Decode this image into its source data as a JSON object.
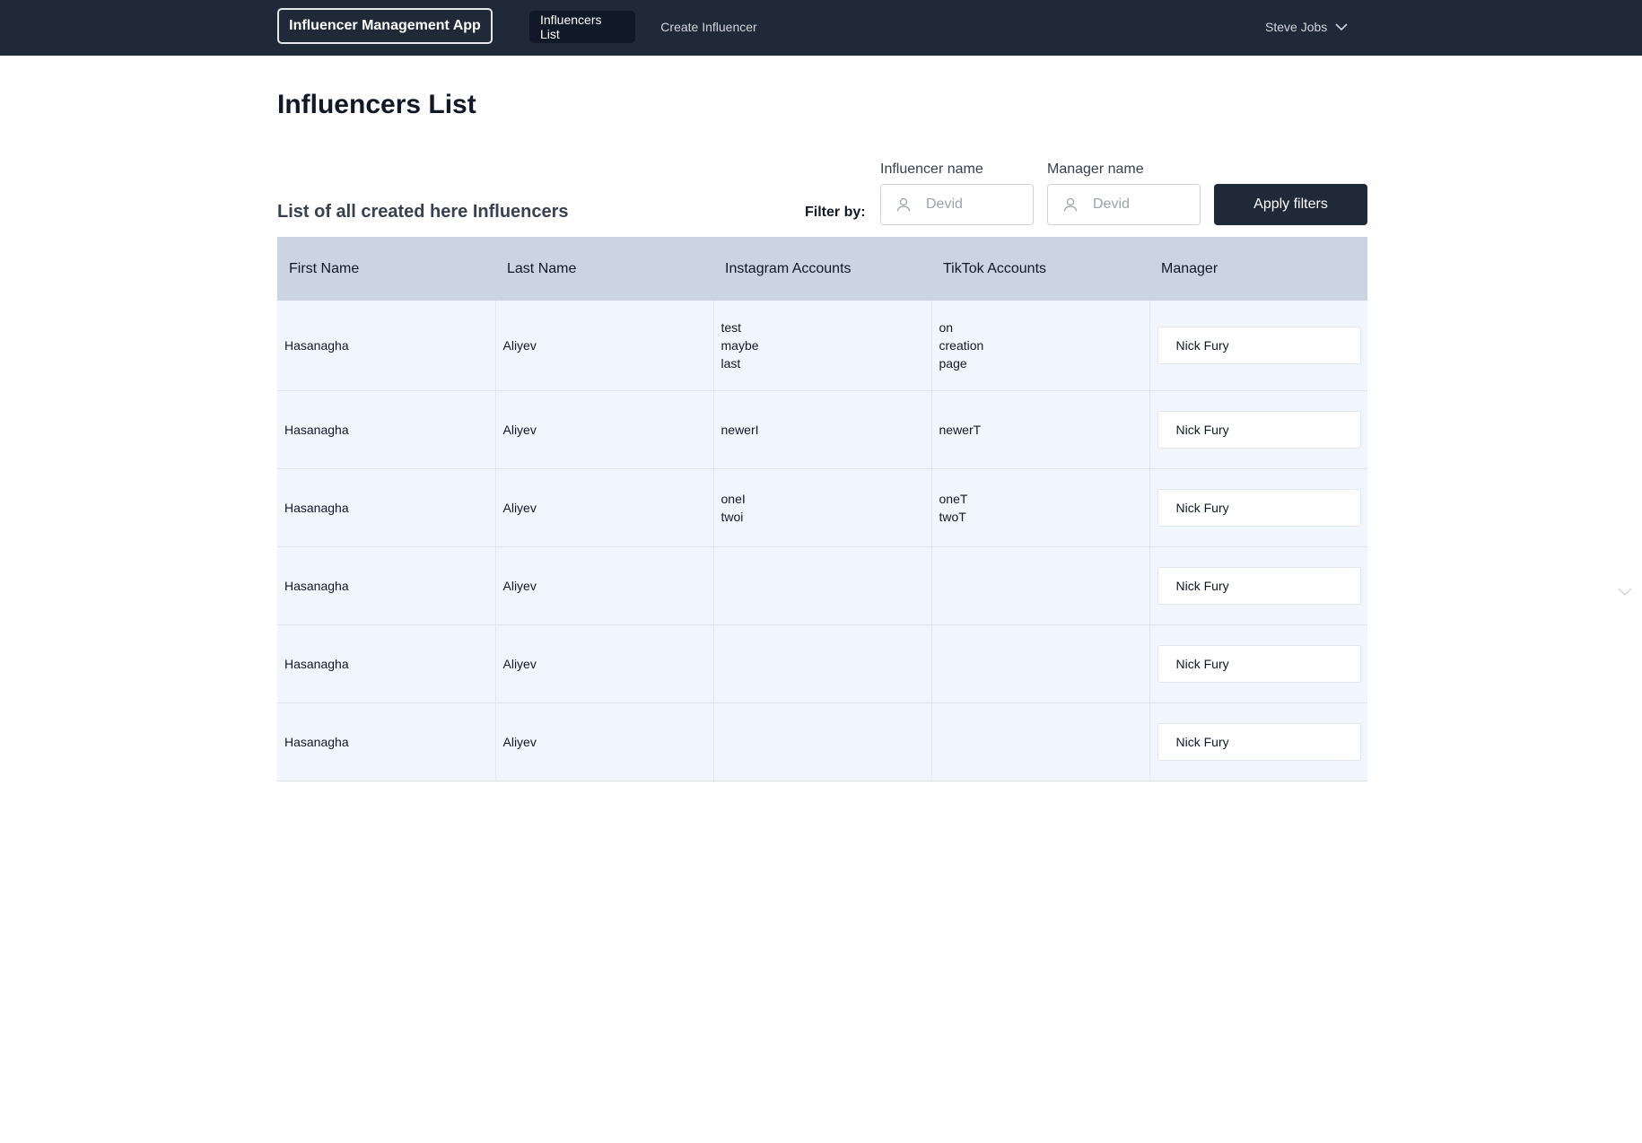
{
  "nav": {
    "brand": "Influencer Management App",
    "links": [
      "Influencers List",
      "Create Influencer"
    ],
    "user": "Steve Jobs"
  },
  "page": {
    "title": "Influencers List",
    "subtitle": "List of all created here Influencers"
  },
  "filters": {
    "label": "Filter by:",
    "influencer_label": "Influencer name",
    "influencer_placeholder": "Devid",
    "manager_label": "Manager name",
    "manager_placeholder": "Devid",
    "apply_label": "Apply filters"
  },
  "table": {
    "headers": [
      "First Name",
      "Last Name",
      "Instagram Accounts",
      "TikTok Accounts",
      "Manager"
    ],
    "rows": [
      {
        "first": "Hasanagha",
        "last": "Aliyev",
        "instagram": [
          "test",
          "maybe",
          "last"
        ],
        "tiktok": [
          "on",
          "creation",
          "page"
        ],
        "manager": "Nick Fury"
      },
      {
        "first": "Hasanagha",
        "last": "Aliyev",
        "instagram": [
          "newerI"
        ],
        "tiktok": [
          "newerT"
        ],
        "manager": "Nick Fury"
      },
      {
        "first": "Hasanagha",
        "last": "Aliyev",
        "instagram": [
          "oneI",
          "twoi"
        ],
        "tiktok": [
          "oneT",
          "twoT"
        ],
        "manager": "Nick Fury"
      },
      {
        "first": "Hasanagha",
        "last": "Aliyev",
        "instagram": [],
        "tiktok": [],
        "manager": "Nick Fury"
      },
      {
        "first": "Hasanagha",
        "last": "Aliyev",
        "instagram": [],
        "tiktok": [],
        "manager": "Nick Fury"
      },
      {
        "first": "Hasanagha",
        "last": "Aliyev",
        "instagram": [],
        "tiktok": [],
        "manager": "Nick Fury"
      }
    ]
  }
}
